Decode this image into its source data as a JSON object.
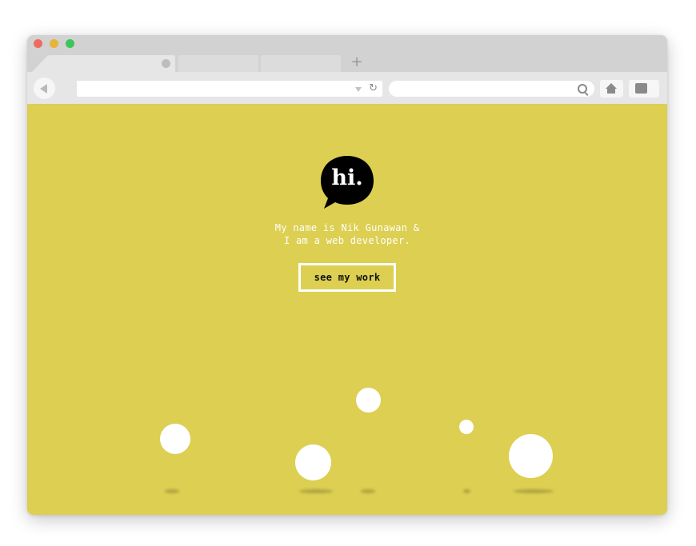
{
  "browser": {
    "new_tab_symbol": "+",
    "reload_symbol": "↻",
    "icons": {
      "back": "back-arrow-icon",
      "reload": "reload-icon",
      "search": "search-icon",
      "home": "home-icon",
      "menu": "menu-icon"
    }
  },
  "page": {
    "background_color": "#dccf52",
    "logo_text": "hi.",
    "intro_line1": "My name is Nik Gunawan &",
    "intro_line2": "I am a web developer.",
    "cta_label": "see my work"
  },
  "colors": {
    "accent": "#dccf52",
    "logo_bubble": "#000000",
    "text": "#ffffff",
    "cta_text": "#111111"
  }
}
